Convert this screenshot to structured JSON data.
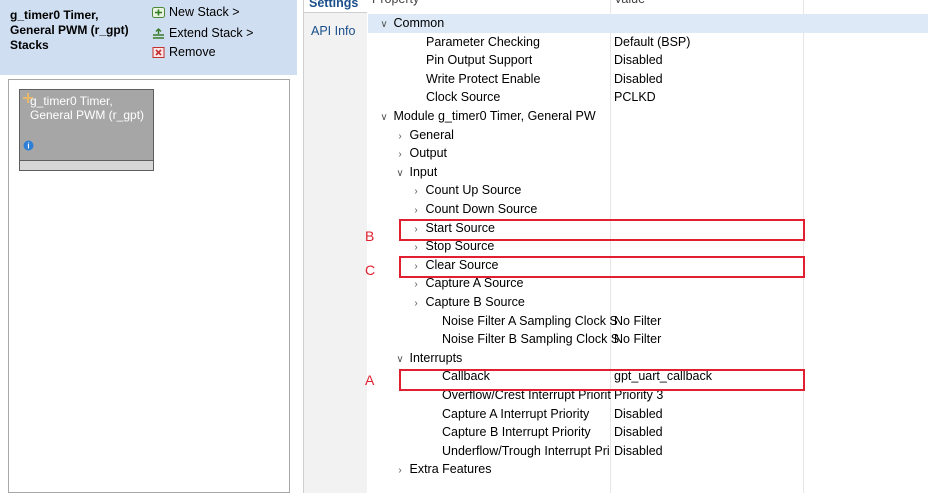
{
  "stacks": {
    "title": "g_timer0 Timer, General PWM (r_gpt) Stacks",
    "new_stack": "New Stack >",
    "extend_stack": "Extend Stack >",
    "remove": "Remove",
    "module_label": "g_timer0 Timer, General PWM (r_gpt)",
    "info_icon_text": "i"
  },
  "tabs": {
    "settings": "Settings",
    "api_info": "API Info"
  },
  "table": {
    "header_property": "Property",
    "header_value": "Value",
    "rows": [
      {
        "label": "Common",
        "value": "",
        "toggle": "open"
      },
      {
        "label": "Parameter Checking",
        "value": "Default (BSP)",
        "toggle": ""
      },
      {
        "label": "Pin Output Support",
        "value": "Disabled",
        "toggle": ""
      },
      {
        "label": "Write Protect Enable",
        "value": "Disabled",
        "toggle": ""
      },
      {
        "label": "Clock Source",
        "value": "PCLKD",
        "toggle": ""
      },
      {
        "label": "Module g_timer0 Timer, General PW",
        "value": "",
        "toggle": "open"
      },
      {
        "label": "General",
        "value": "",
        "toggle": "closed"
      },
      {
        "label": "Output",
        "value": "",
        "toggle": "closed"
      },
      {
        "label": "Input",
        "value": "",
        "toggle": "open"
      },
      {
        "label": "Count Up Source",
        "value": "",
        "toggle": "closed"
      },
      {
        "label": "Count Down Source",
        "value": "",
        "toggle": "closed"
      },
      {
        "label": "Start Source",
        "value": "",
        "toggle": "closed"
      },
      {
        "label": "Stop Source",
        "value": "",
        "toggle": "closed"
      },
      {
        "label": "Clear Source",
        "value": "",
        "toggle": "closed"
      },
      {
        "label": "Capture A Source",
        "value": "",
        "toggle": "closed"
      },
      {
        "label": "Capture B Source",
        "value": "",
        "toggle": "closed"
      },
      {
        "label": "Noise Filter A Sampling Clock S",
        "value": "No Filter",
        "toggle": ""
      },
      {
        "label": "Noise Filter B Sampling Clock S",
        "value": "No Filter",
        "toggle": ""
      },
      {
        "label": "Interrupts",
        "value": "",
        "toggle": "open"
      },
      {
        "label": "Callback",
        "value": "gpt_uart_callback",
        "toggle": ""
      },
      {
        "label": "Overflow/Crest Interrupt Priorit",
        "value": "Priority 3",
        "toggle": ""
      },
      {
        "label": "Capture A Interrupt Priority",
        "value": "Disabled",
        "toggle": ""
      },
      {
        "label": "Capture B Interrupt Priority",
        "value": "Disabled",
        "toggle": ""
      },
      {
        "label": "Underflow/Trough Interrupt Pri",
        "value": "Disabled",
        "toggle": ""
      },
      {
        "label": "Extra Features",
        "value": "",
        "toggle": "closed"
      }
    ]
  },
  "annotations": {
    "a": "A",
    "b": "B",
    "c": "C"
  },
  "colors": {
    "header_bg": "#cfdef0",
    "selected_row": "#dde9f7",
    "highlight": "#e02030",
    "module_box": "#a6a6a6"
  }
}
